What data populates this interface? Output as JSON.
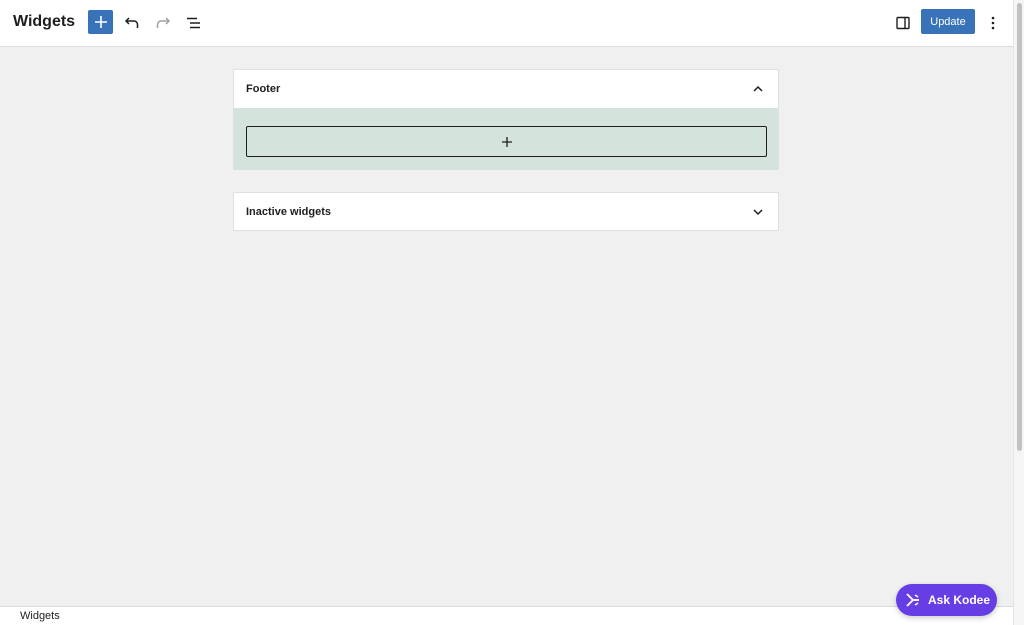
{
  "header": {
    "title": "Widgets",
    "add_block_icon": "plus-icon",
    "undo_icon": "undo-icon",
    "redo_icon": "redo-icon",
    "list_view_icon": "list-view-icon",
    "settings_icon": "sidebar-toggle-icon",
    "update_label": "Update",
    "options_icon": "more-vertical-icon"
  },
  "widget_areas": [
    {
      "title": "Footer",
      "expanded": true,
      "chevron": "chevron-up-icon",
      "appender_icon": "plus-icon"
    },
    {
      "title": "Inactive widgets",
      "expanded": false,
      "chevron": "chevron-down-icon"
    }
  ],
  "footer": {
    "breadcrumb": "Widgets"
  },
  "assistant": {
    "label": "Ask Kodee",
    "icon": "kodee-icon"
  },
  "colors": {
    "accent": "#3872b9",
    "assistant": "#673de6",
    "block_area_bg": "#d4e3dc",
    "canvas_bg": "#f0f0f0"
  }
}
